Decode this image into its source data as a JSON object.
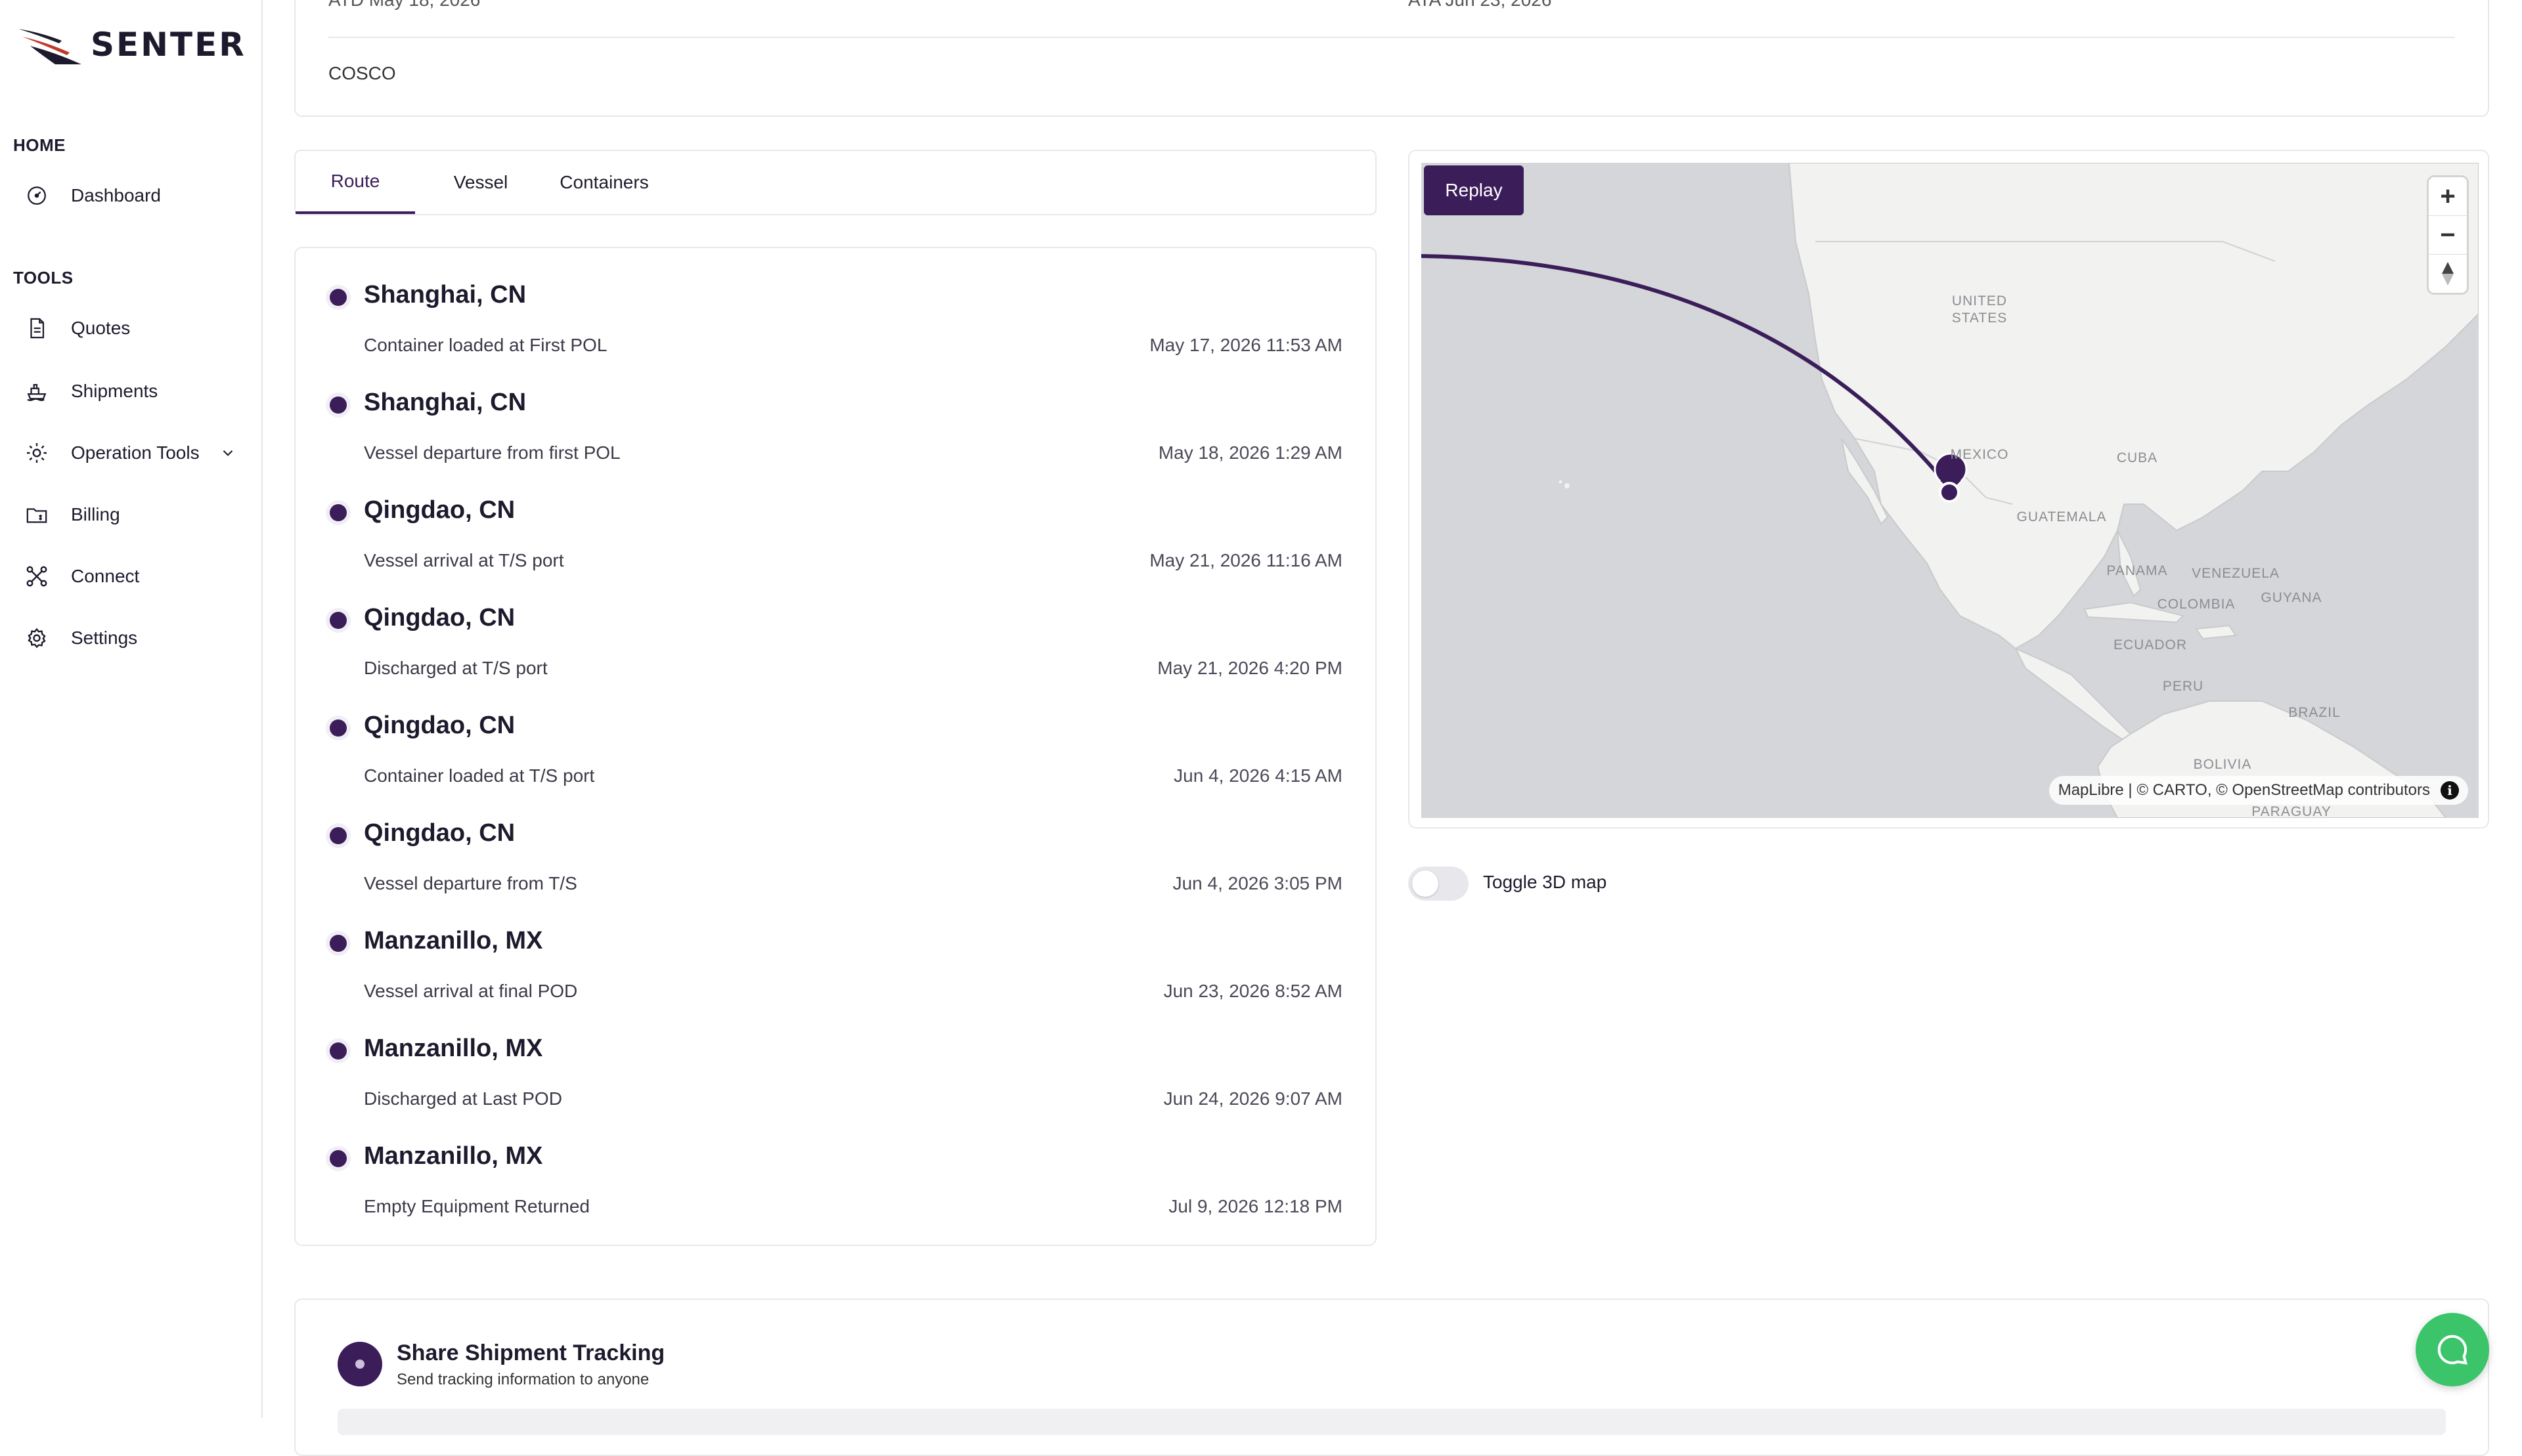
{
  "brand": {
    "name": "SENTER"
  },
  "sidebar": {
    "sections": [
      {
        "title": "HOME"
      },
      {
        "title": "TOOLS"
      }
    ],
    "items": [
      {
        "label": "Dashboard",
        "icon": "dashboard-icon"
      },
      {
        "label": "Quotes",
        "icon": "document-icon"
      },
      {
        "label": "Shipments",
        "icon": "ship-icon"
      },
      {
        "label": "Operation Tools",
        "icon": "gear-icon",
        "expandable": true
      },
      {
        "label": "Billing",
        "icon": "folder-dollar-icon"
      },
      {
        "label": "Connect",
        "icon": "network-icon"
      },
      {
        "label": "Settings",
        "icon": "settings-icon"
      }
    ]
  },
  "summary": {
    "atd": "ATD May 18, 2026",
    "ata": "ATA Jun 23, 2026",
    "carrier": "COSCO"
  },
  "tabs": [
    {
      "label": "Route",
      "active": true
    },
    {
      "label": "Vessel",
      "active": false
    },
    {
      "label": "Containers",
      "active": false
    }
  ],
  "route": {
    "events": [
      {
        "place": "Shanghai, CN",
        "description": "Container loaded at First POL",
        "time": "May 17, 2026 11:53 AM"
      },
      {
        "place": "Shanghai, CN",
        "description": "Vessel departure from first POL",
        "time": "May 18, 2026 1:29 AM"
      },
      {
        "place": "Qingdao, CN",
        "description": "Vessel arrival at T/S port",
        "time": "May 21, 2026 11:16 AM"
      },
      {
        "place": "Qingdao, CN",
        "description": "Discharged at T/S port",
        "time": "May 21, 2026 4:20 PM"
      },
      {
        "place": "Qingdao, CN",
        "description": "Container loaded at T/S port",
        "time": "Jun 4, 2026 4:15 AM"
      },
      {
        "place": "Qingdao, CN",
        "description": "Vessel departure from T/S",
        "time": "Jun 4, 2026 3:05 PM"
      },
      {
        "place": "Manzanillo, MX",
        "description": "Vessel arrival at final POD",
        "time": "Jun 23, 2026 8:52 AM"
      },
      {
        "place": "Manzanillo, MX",
        "description": "Discharged at Last POD",
        "time": "Jun 24, 2026 9:07 AM"
      },
      {
        "place": "Manzanillo, MX",
        "description": "Empty Equipment Returned",
        "time": "Jul 9, 2026 12:18 PM"
      }
    ]
  },
  "map": {
    "replay_label": "Replay",
    "zoom_in": "+",
    "zoom_out": "−",
    "attribution": "MapLibre | © CARTO, © OpenStreetMap contributors",
    "info": "i",
    "labels": {
      "us": "UNITED STATES",
      "mexico": "MEXICO",
      "cuba": "CUBA",
      "guatemala": "GUATEMALA",
      "panama": "PANAMA",
      "venezuela": "VENEZUELA",
      "guyana": "GUYANA",
      "colombia": "COLOMBIA",
      "ecuador": "ECUADOR",
      "peru": "PERU",
      "brazil": "BRAZIL",
      "bolivia": "BOLIVIA",
      "paraguay": "PARAGUAY"
    },
    "colors": {
      "water": "#d4d6d9",
      "land": "#f2f2f0",
      "route": "#3b1d5a"
    }
  },
  "toggle_3d": {
    "label": "Toggle 3D map",
    "enabled": false
  },
  "share": {
    "title": "Share Shipment Tracking",
    "subtitle": "Send tracking information to anyone"
  },
  "colors": {
    "accent": "#3b1d5a",
    "chat": "#3cc46a"
  }
}
